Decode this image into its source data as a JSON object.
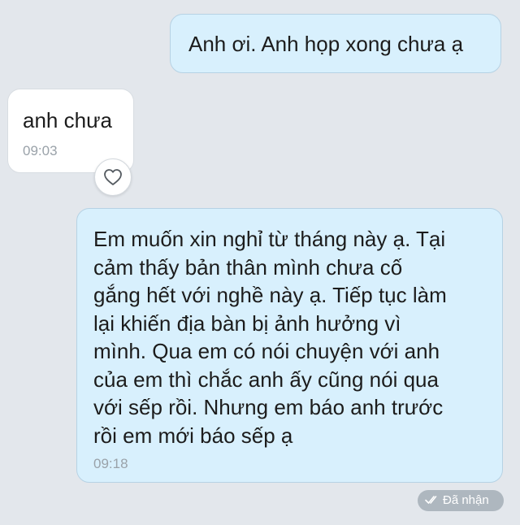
{
  "messages": [
    {
      "direction": "sent",
      "text": "Anh ơi. Anh họp xong chưa ạ",
      "time": ""
    },
    {
      "direction": "received",
      "text": "anh chưa",
      "time": "09:03"
    },
    {
      "direction": "sent",
      "lines": [
        "Em muốn xin nghỉ từ tháng này ạ. Tại",
        "cảm thấy bản thân mình chưa cố",
        "gắng hết với nghề này ạ. Tiếp tục làm",
        "lại khiến địa bàn bị ảnh hưởng vì",
        "mình. Qua em có nói chuyện với anh",
        "của em thì chắc anh ấy cũng nói qua",
        "với sếp rồi. Nhưng em báo anh trước",
        "rồi em mới báo sếp ạ"
      ],
      "time": "09:18"
    }
  ],
  "reaction_button": {
    "icon": "heart-outline-icon"
  },
  "status": {
    "icon": "double-check-icon",
    "label": "Đã nhận"
  },
  "colors": {
    "background": "#e3e7ec",
    "sent_bubble": "#d8f0fd",
    "received_bubble": "#ffffff",
    "timestamp": "#9aa2a9",
    "status_badge": "#aeb7bf"
  }
}
